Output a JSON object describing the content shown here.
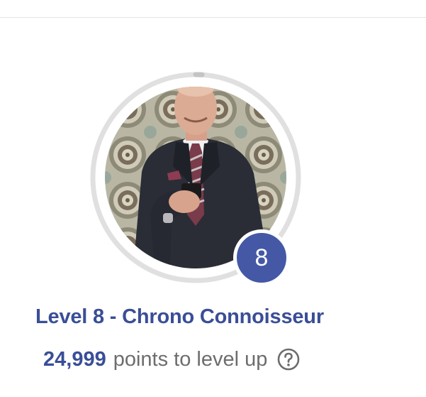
{
  "profile": {
    "avatar_alt": "Profile photo",
    "level_badge": "8",
    "level_title": "Level 8 - Chrono Connoisseur",
    "points_value": "24,999",
    "points_suffix": "points to level up",
    "help_icon": "question-circle-icon",
    "progress_fraction": 0.01
  },
  "colors": {
    "accent": "#3a4e97",
    "badge": "#4458a6",
    "ring_track": "#e0e0e0",
    "muted_text": "#6d6d6d"
  }
}
